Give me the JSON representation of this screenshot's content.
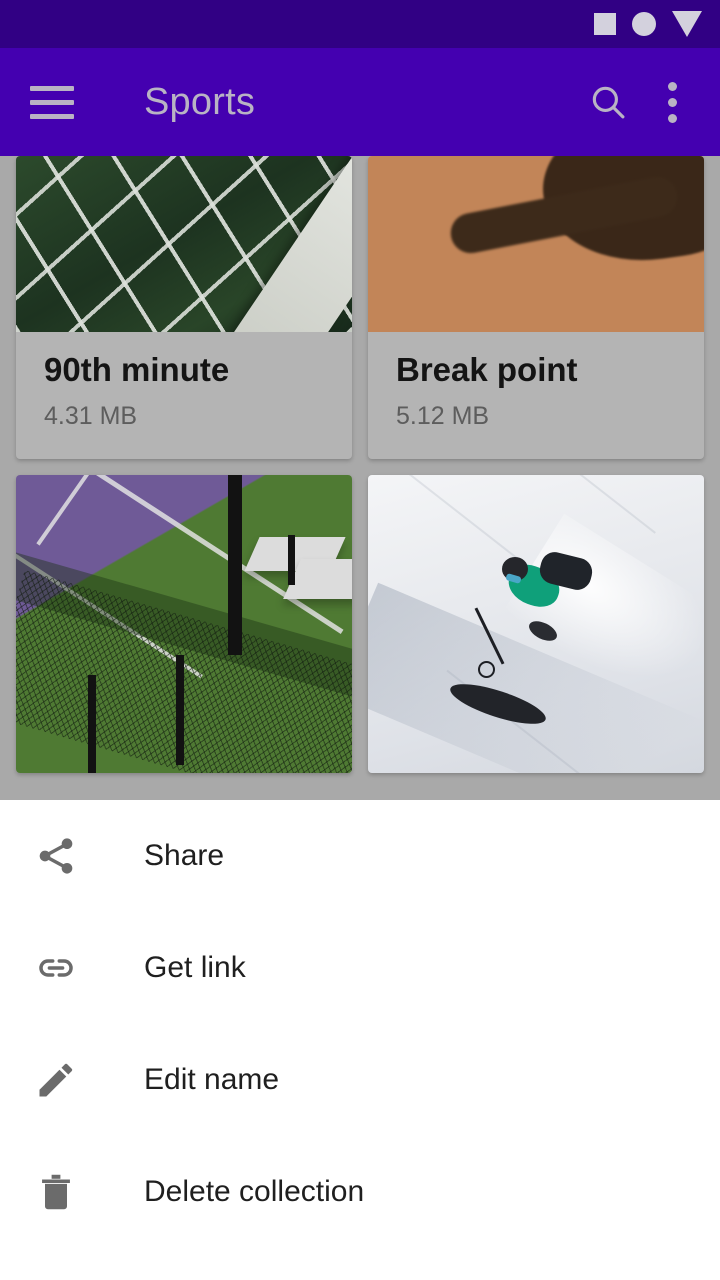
{
  "status_bar": {
    "icons": [
      "square-icon",
      "circle-icon",
      "triangle-down-icon"
    ],
    "background_color": "#310084",
    "icon_color": "#d3d1dd"
  },
  "app_bar": {
    "title": "Sports",
    "background_color": "#4400b0",
    "foreground_color": "#b9b3c4",
    "menu_icon": "hamburger-menu-icon",
    "search_icon": "search-icon",
    "overflow_icon": "more-vert-icon"
  },
  "collection_grid": {
    "scrim_color": "#a9a9a9",
    "card_color": "#b4b4b4",
    "cards": [
      {
        "title": "90th minute",
        "size": "4.31 MB",
        "thumb": "soccer-goal-net-photo"
      },
      {
        "title": "Break point",
        "size": "5.12 MB",
        "thumb": "clay-court-shadow-photo"
      }
    ],
    "cards_row2": [
      {
        "thumb": "aerial-tennis-court-photo"
      },
      {
        "thumb": "skier-powder-snow-photo"
      }
    ]
  },
  "bottom_sheet": {
    "background_color": "#ffffff",
    "icon_color": "#6b6b6b",
    "items": [
      {
        "label": "Share",
        "icon": "share-icon"
      },
      {
        "label": "Get link",
        "icon": "link-icon"
      },
      {
        "label": "Edit name",
        "icon": "pencil-edit-icon"
      },
      {
        "label": "Delete collection",
        "icon": "trash-delete-icon"
      }
    ]
  }
}
